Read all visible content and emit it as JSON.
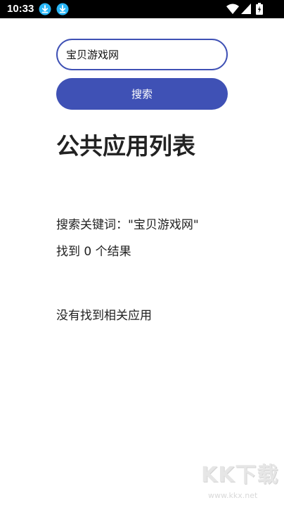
{
  "status_bar": {
    "time": "10:33",
    "icons": [
      "download-icon",
      "download-icon",
      "wifi-icon",
      "signal-icon",
      "battery-icon"
    ]
  },
  "search": {
    "value": "宝贝游戏网",
    "button_label": "搜索"
  },
  "page": {
    "title": "公共应用列表",
    "keyword_line": "搜索关键词：\"宝贝游戏网\"",
    "count_line": "找到 0 个结果",
    "empty_message": "没有找到相关应用"
  },
  "watermark": {
    "logo": "KK下载",
    "url": "www.kkx.net"
  },
  "colors": {
    "accent": "#3f51b5",
    "status_bar": "#000000",
    "download_badge": "#29b6f6"
  }
}
